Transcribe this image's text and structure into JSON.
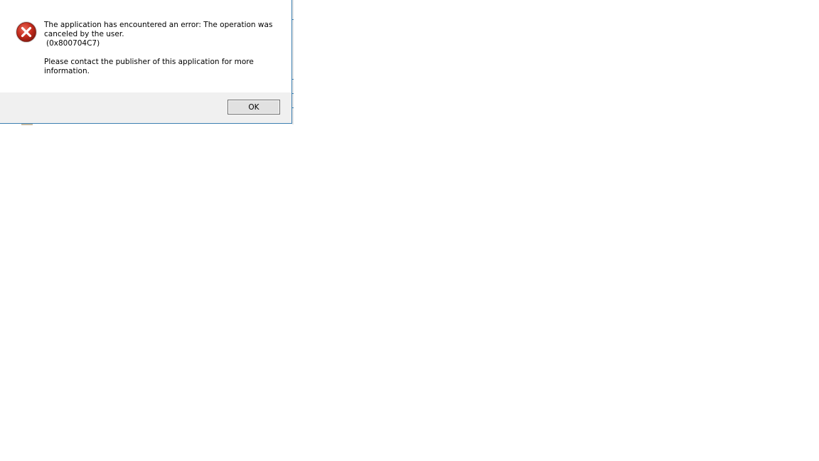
{
  "dialog": {
    "icon": "error-x-icon",
    "message_line1": "The application has encountered an error: The operation was canceled by the user.",
    "message_code": "(0x800704C7)",
    "message_line2": "Please contact the publisher of this application for more information.",
    "ok_label": "OK"
  },
  "colors": {
    "border": "#3c7fb1",
    "footer_bg": "#f0f0f0",
    "icon_red": "#c42b1c"
  }
}
